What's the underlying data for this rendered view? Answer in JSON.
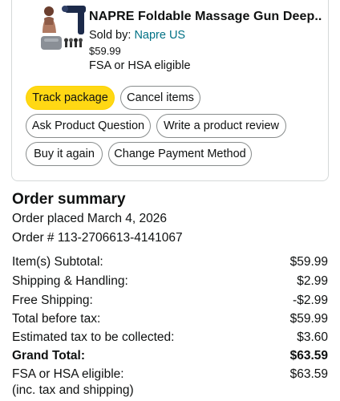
{
  "product": {
    "title": "NAPRE Foldable Massage Gun Deep...",
    "sold_by_prefix": "Sold by:",
    "seller": "Napre US",
    "price": "$59.99",
    "eligibility": "FSA or HSA eligible",
    "thumbnail_icon": "massage-gun-product-image"
  },
  "actions": {
    "track_package": "Track package",
    "cancel_items": "Cancel items",
    "ask_question": "Ask Product Question",
    "write_review": "Write a product review",
    "buy_again": "Buy it again",
    "change_payment": "Change Payment Method"
  },
  "summary": {
    "title": "Order summary",
    "order_placed": "Order placed March 4, 2026",
    "order_number": "Order # 113-2706613-4141067",
    "rows": [
      {
        "label": "Item(s) Subtotal:",
        "value": "$59.99"
      },
      {
        "label": "Shipping & Handling:",
        "value": "$2.99"
      },
      {
        "label": "Free Shipping:",
        "value": "-$2.99"
      },
      {
        "label": "Total before tax:",
        "value": "$59.99"
      },
      {
        "label": "Estimated tax to be collected:",
        "value": "$3.60"
      },
      {
        "label": "Grand Total:",
        "value": "$63.59"
      },
      {
        "label": "FSA or HSA eligible:",
        "value": "$63.59"
      }
    ],
    "fsa_note": "(inc. tax and shipping)"
  },
  "colors": {
    "link": "#007185",
    "primary_button": "#ffd814",
    "border": "#d5d9d9"
  }
}
